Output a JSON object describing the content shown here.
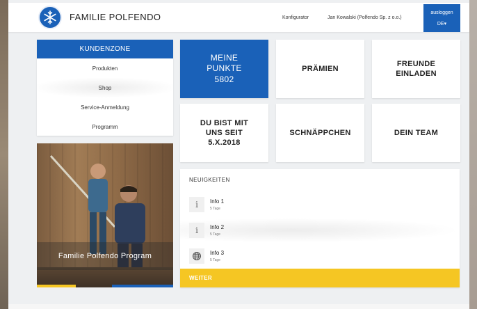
{
  "header": {
    "brand": "FAMILIE POLFENDO",
    "configurator": "Konfigurator",
    "user": "Jan Kowalski (Polfendo Sp. z o.o.)",
    "logout": "ausloggen",
    "language": "DE",
    "language_caret": "▾"
  },
  "sidebar": {
    "title": "KUNDENZONE",
    "items": [
      {
        "label": "Produkten"
      },
      {
        "label": "Shop"
      },
      {
        "label": "Service-Anmeldung"
      },
      {
        "label": "Programm"
      }
    ]
  },
  "promo": {
    "caption": "Familie Polfendo Program"
  },
  "tiles": {
    "points": {
      "line1": "MEINE",
      "line2": "PUNKTE",
      "value": "5802"
    },
    "rewards": {
      "label": "PRÄMIEN"
    },
    "invite": {
      "line1": "FREUNDE",
      "line2": "EINLADEN"
    },
    "member_since": {
      "line1": "DU BIST MIT",
      "line2": "UNS SEIT",
      "line3": "5.X.2018"
    },
    "bargains": {
      "label": "SCHNÄPPCHEN"
    },
    "team": {
      "label": "DEIN TEAM"
    }
  },
  "news": {
    "title": "NEUIGKEITEN",
    "items": [
      {
        "icon": "i",
        "label": "Info 1",
        "age": "5 Tage"
      },
      {
        "icon": "i",
        "label": "Info 2",
        "age": "5 Tage"
      },
      {
        "icon": "globe",
        "label": "Info 3",
        "age": "5 Tage"
      }
    ],
    "more": "WEITER"
  },
  "colors": {
    "primary": "#1a61b8",
    "accent": "#f5c623",
    "background": "#eef0f2"
  }
}
